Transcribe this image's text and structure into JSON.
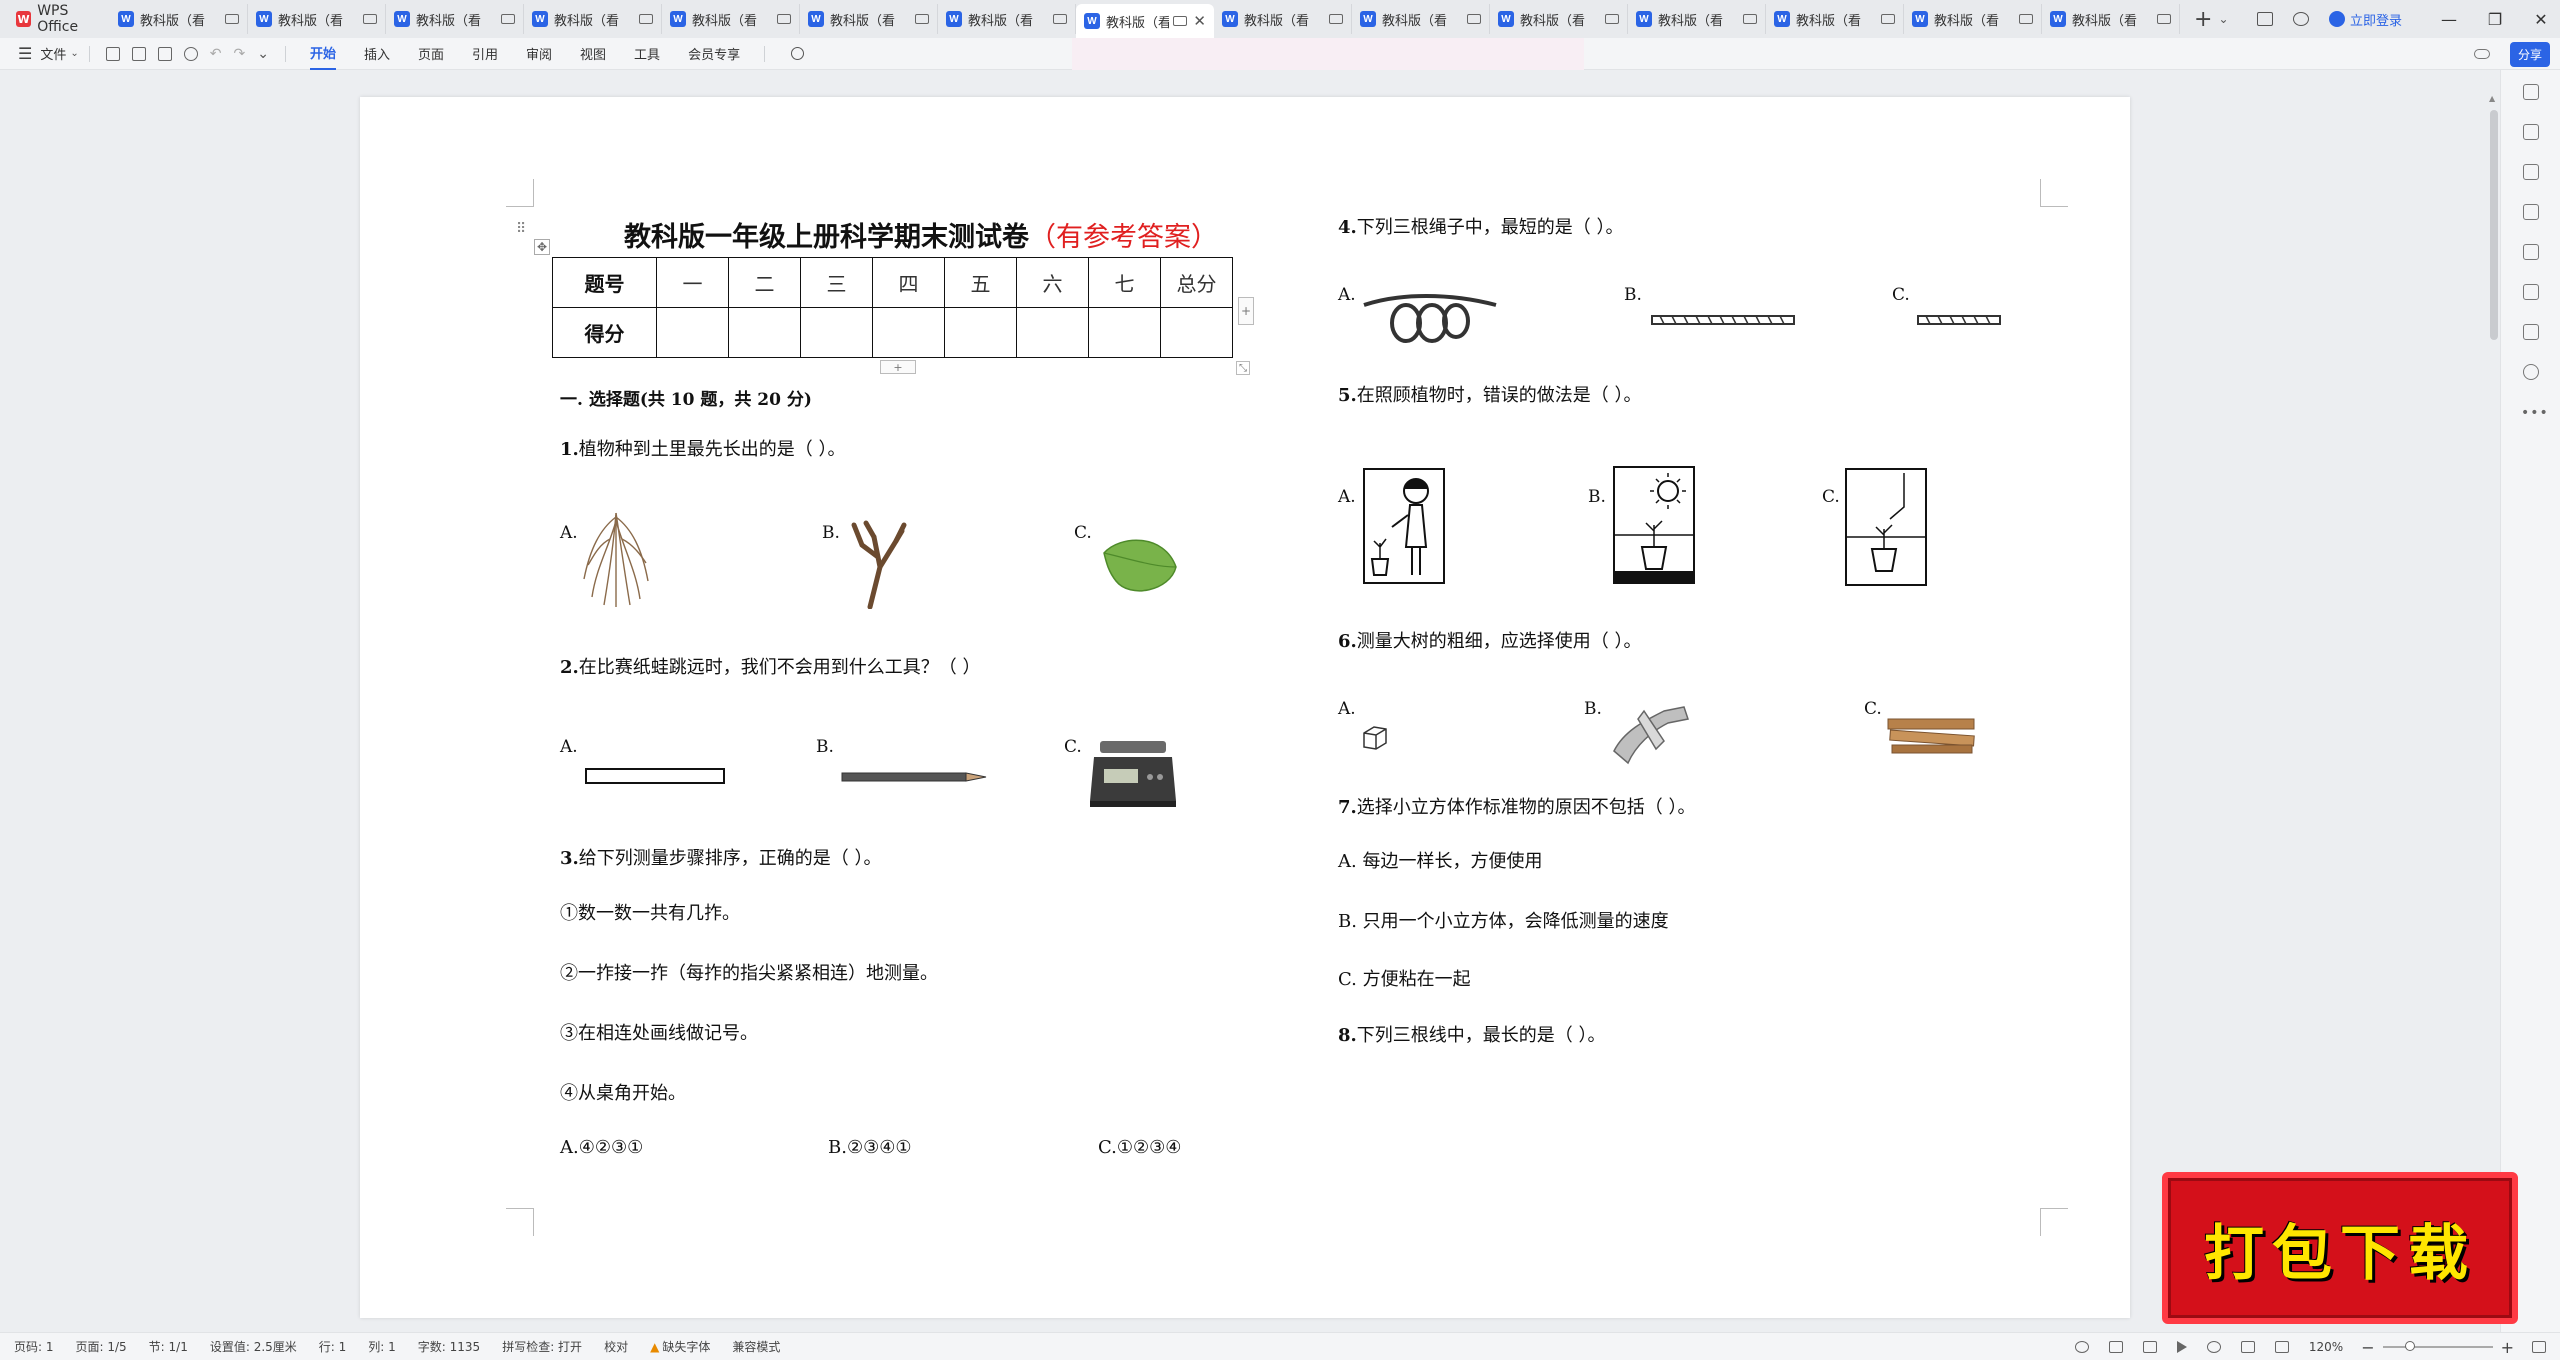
{
  "app": {
    "name": "WPS Office",
    "tab_label": "教科版（看",
    "active_tab_index": 7,
    "tab_count": 15,
    "login_label": "立即登录"
  },
  "toolbar": {
    "file_menu": "文件",
    "tabs": [
      "开始",
      "插入",
      "页面",
      "引用",
      "审阅",
      "视图",
      "工具",
      "会员专享"
    ],
    "active_tab": "开始",
    "share_label": "分享"
  },
  "document": {
    "title": "教科版一年级上册科学期末测试卷",
    "title_suffix": "（有参考答案）",
    "score_table": {
      "header": [
        "题号",
        "一",
        "二",
        "三",
        "四",
        "五",
        "六",
        "七",
        "总分"
      ],
      "row_label": "得分"
    },
    "section1": "一. 选择题(共 10 题，共 20 分)",
    "q1": {
      "num": "1.",
      "text": "植物种到土里最先长出的是（          ）。",
      "options": [
        "A.",
        "B.",
        "C."
      ]
    },
    "q2": {
      "num": "2.",
      "text": "在比赛纸蛙跳远时，我们不会用到什么工具？（          ）",
      "options": [
        "A.",
        "B.",
        "C."
      ]
    },
    "q3": {
      "num": "3.",
      "text": "给下列测量步骤排序，正确的是（          ）。",
      "steps": [
        "①数一数一共有几拃。",
        "②一拃接一拃（每拃的指尖紧紧相连）地测量。",
        "③在相连处画线做记号。",
        "④从桌角开始。"
      ],
      "options": [
        "A.④②③①",
        "B.②③④①",
        "C.①②③④"
      ]
    },
    "q4": {
      "num": "4.",
      "text": "下列三根绳子中，最短的是（          ）。",
      "options": [
        "A.",
        "B.",
        "C."
      ]
    },
    "q5": {
      "num": "5.",
      "text": "在照顾植物时，错误的做法是（          ）。",
      "options": [
        "A.",
        "B.",
        "C."
      ]
    },
    "q6": {
      "num": "6.",
      "text": "测量大树的粗细，应选择使用（          ）。",
      "options": [
        "A.",
        "B.",
        "C."
      ]
    },
    "q7": {
      "num": "7.",
      "text": "选择小立方体作标准物的原因不包括（          ）。",
      "options": [
        "A. 每边一样长，方便使用",
        "B. 只用一个小立方体，会降低测量的速度",
        "C. 方便粘在一起"
      ]
    },
    "q8": {
      "num": "8.",
      "text": "下列三根线中，最长的是（          ）。"
    }
  },
  "statusbar": {
    "page_num": "页码: 1",
    "pages": "页面: 1/5",
    "section": "节: 1/1",
    "setting": "设置值: 2.5厘米",
    "row": "行: 1",
    "col": "列: 1",
    "words": "字数: 1135",
    "spell": "拼写检查: 打开",
    "proof": "校对",
    "missing_font": "缺失字体",
    "compat": "兼容模式",
    "zoom": "120%"
  },
  "zoom_level": 120,
  "stamp_text": "打包下载",
  "colors": {
    "accent": "#2b64e5",
    "title_red": "#e02020",
    "stamp_red": "#d4101a",
    "stamp_yellow": "#ffe600"
  }
}
